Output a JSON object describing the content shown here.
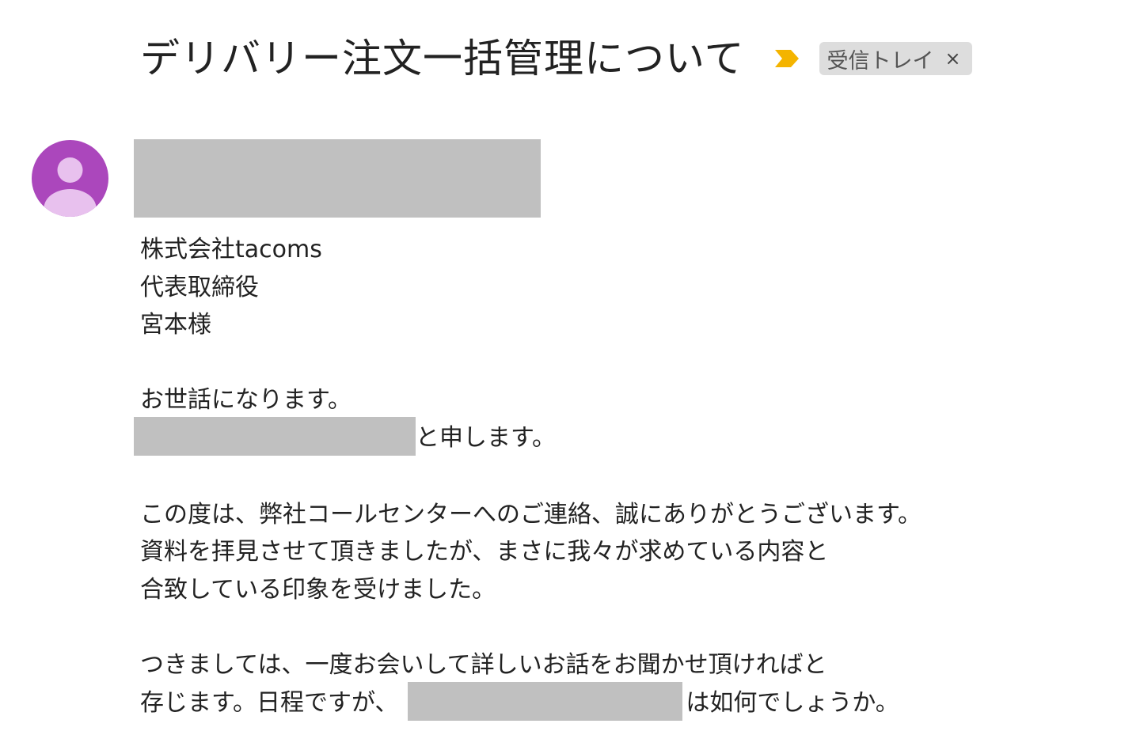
{
  "email": {
    "subject": "デリバリー注文一括管理について",
    "label": "受信トレイ",
    "label_close": "×",
    "importance_icon": "importance-marker-icon",
    "importance_color": "#f4b400",
    "avatar_color": "#ab47bc",
    "avatar_icon": "person-icon"
  },
  "body": {
    "line1": "株式会社tacoms",
    "line2": "代表取締役",
    "line3": "宮本様",
    "greeting": "お世話になります。",
    "intro_suffix": "と申します。",
    "para1_line1": "この度は、弊社コールセンターへのご連絡、誠にありがとうございます。",
    "para1_line2": "資料を拝見させて頂きましたが、まさに我々が求めている内容と",
    "para1_line3": "合致している印象を受けました。",
    "para2_line1": "つきましては、一度お会いして詳しいお話をお聞かせ頂ければと",
    "para2_line2_prefix": "存じます。日程ですが、",
    "para2_line2_suffix": "は如何でしょうか。"
  }
}
